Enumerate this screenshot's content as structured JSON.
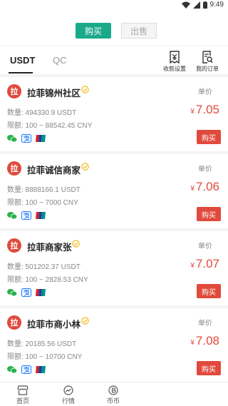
{
  "status_bar": {
    "time": "9:49"
  },
  "header": {
    "buy_label": "购买",
    "sell_label": "出售"
  },
  "tabs": [
    {
      "label": "USDT"
    },
    {
      "label": "QC"
    }
  ],
  "tools": {
    "payment_settings": "收款设置",
    "my_orders": "我的订单"
  },
  "listing": {
    "unit_price_label": "单价",
    "currency_symbol": "¥",
    "buy_button": "购买",
    "avatar_char": "拉",
    "items": [
      {
        "name": "拉菲锦州社区",
        "quantity": "数量: 494330.9 USDT",
        "limit": "限额: 100 ~ 88542.45 CNY",
        "price": "7.05"
      },
      {
        "name": "拉菲诚信商家",
        "quantity": "数量: 8888166.1 USDT",
        "limit": "限额: 100 ~ 7000 CNY",
        "price": "7.06"
      },
      {
        "name": "拉菲商家张",
        "quantity": "数量: 501202.37 USDT",
        "limit": "限额: 100 ~ 2828.53 CNY",
        "price": "7.07"
      },
      {
        "name": "拉菲市商小林",
        "quantity": "数量: 20185.56 USDT",
        "limit": "限额: 100 ~ 10700 CNY",
        "price": "7.08"
      }
    ]
  },
  "bottom_nav": [
    {
      "label": "首页"
    },
    {
      "label": "行情"
    },
    {
      "label": "币币"
    }
  ],
  "colors": {
    "accent_green": "#1aaa8a",
    "accent_red": "#e04a3c",
    "wechat_green": "#2bb24c",
    "alipay_blue": "#1677ff"
  }
}
